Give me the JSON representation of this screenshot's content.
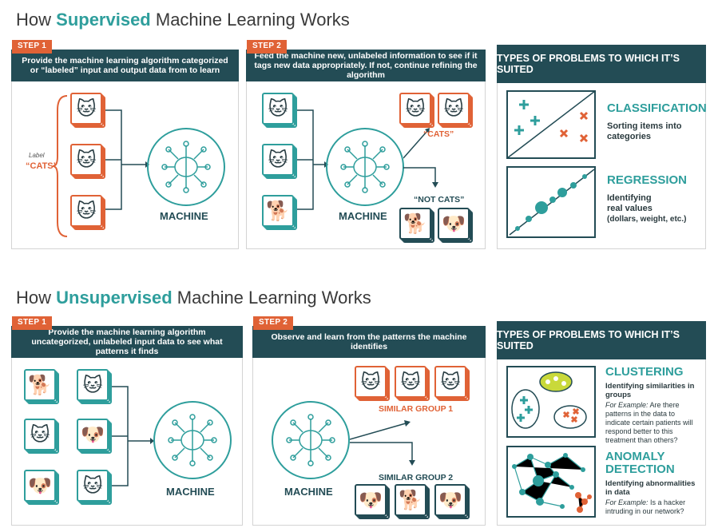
{
  "supervised": {
    "title_prefix": "How",
    "title_highlight": "Supervised",
    "title_suffix": "Machine Learning Works",
    "step1": {
      "tag": "STEP 1",
      "text": "Provide the machine learning algorithm categorized or “labeled” input and output data from to learn"
    },
    "step2": {
      "tag": "STEP 2",
      "text": "Feed the machine new, unlabeled information to see if it tags new data appropriately. If not, continue refining the algorithm"
    },
    "label_small": "Label",
    "label_cats": "“CATS”",
    "machine": "MACHINE",
    "cats": "“CATS”",
    "not_cats": "“NOT CATS”",
    "types_header": "TYPES OF PROBLEMS TO WHICH IT’S SUITED",
    "classification": {
      "title": "CLASSIFICATION",
      "desc": "Sorting items into categories"
    },
    "regression": {
      "title": "REGRESSION",
      "desc1": "Identifying",
      "desc2": "real values",
      "desc3": "(dollars, weight, etc.)"
    }
  },
  "unsupervised": {
    "title_prefix": "How",
    "title_highlight": "Unsupervised",
    "title_suffix": "Machine Learning Works",
    "step1": {
      "tag": "STEP 1",
      "text": "Provide the machine learning algorithm uncategorized, unlabeled input data to see what patterns it finds"
    },
    "step2": {
      "tag": "STEP 2",
      "text": "Observe and learn from the patterns the machine identifies"
    },
    "machine1": "MACHINE",
    "machine2": "MACHINE",
    "group1": "SIMILAR GROUP 1",
    "group2": "SIMILAR GROUP 2",
    "types_header": "TYPES OF PROBLEMS TO WHICH IT’S SUITED",
    "clustering": {
      "title": "CLUSTERING",
      "desc": "Identifying similarities in groups",
      "ex_label": "For Example:",
      "ex": "Are there patterns in the data to indicate certain patients will respond better to this treatment than others?"
    },
    "anomaly": {
      "title1": "ANOMALY",
      "title2": "DETECTION",
      "desc": "Identifying abnormalities in data",
      "ex_label": "For Example:",
      "ex": "Is a hacker intruding in our network?"
    }
  },
  "colors": {
    "teal": "#2e9e9c",
    "navy": "#234c55",
    "orange": "#e06236"
  },
  "icons": [
    "cat-icon",
    "dog-icon",
    "brain-network-icon",
    "arrow-icon",
    "plus-icon",
    "x-icon"
  ]
}
